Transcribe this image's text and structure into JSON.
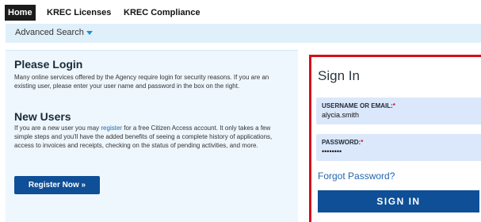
{
  "nav": {
    "tabs": [
      {
        "label": "Home"
      },
      {
        "label": "KREC Licenses"
      },
      {
        "label": "KREC Compliance"
      }
    ]
  },
  "subbar": {
    "advanced_search": "Advanced Search"
  },
  "login_info": {
    "heading": "Please Login",
    "text": "Many online services offered by the Agency require login for security reasons. If you are an existing user, please enter your user name and password in the box on the right.",
    "new_users_heading": "New Users",
    "new_users_text_before": "If you are a new user you may ",
    "register_link": "register",
    "new_users_text_after": " for a free Citizen Access account. It only takes a few simple steps and you'll have the added benefits of seeing a complete history of applications, access to invoices and receipts, checking on the status of pending activities, and more.",
    "register_button": "Register Now »"
  },
  "signin": {
    "title": "Sign In",
    "username_label": "USERNAME OR EMAIL:",
    "username_value": "alycia.smith",
    "password_label": "PASSWORD:",
    "password_value": "••••••••",
    "required_marker": "*",
    "forgot_link": "Forgot Password?",
    "submit": "SIGN IN"
  },
  "colors": {
    "accent_blue": "#0e4f97",
    "highlight_red": "#d40f1c",
    "link_blue": "#2367b0",
    "panel_bg": "#eef7fd",
    "field_bg": "#dbe8fb"
  }
}
